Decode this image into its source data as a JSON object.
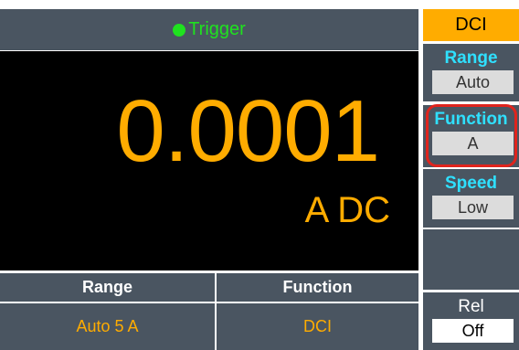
{
  "status": {
    "trigger_label": "Trigger",
    "indicator_color": "#1fe21f"
  },
  "measurement": {
    "reading": "0.0001",
    "unit": "A DC",
    "reading_color": "#ffac00"
  },
  "bottom": {
    "range_label": "Range",
    "range_value": "Auto 5 A",
    "function_label": "Function",
    "function_value": "DCI"
  },
  "side": {
    "mode": "DCI",
    "softkeys": [
      {
        "label": "Range",
        "value": "Auto"
      },
      {
        "label": "Function",
        "value": "A"
      },
      {
        "label": "Speed",
        "value": "Low"
      },
      {
        "label": "",
        "value": ""
      },
      {
        "label": "Rel",
        "value": "Off"
      }
    ]
  },
  "colors": {
    "panel": "#4a5561",
    "accent": "#ffac00",
    "softkey_label": "#2fe0ff",
    "highlight": "#e0241d"
  }
}
